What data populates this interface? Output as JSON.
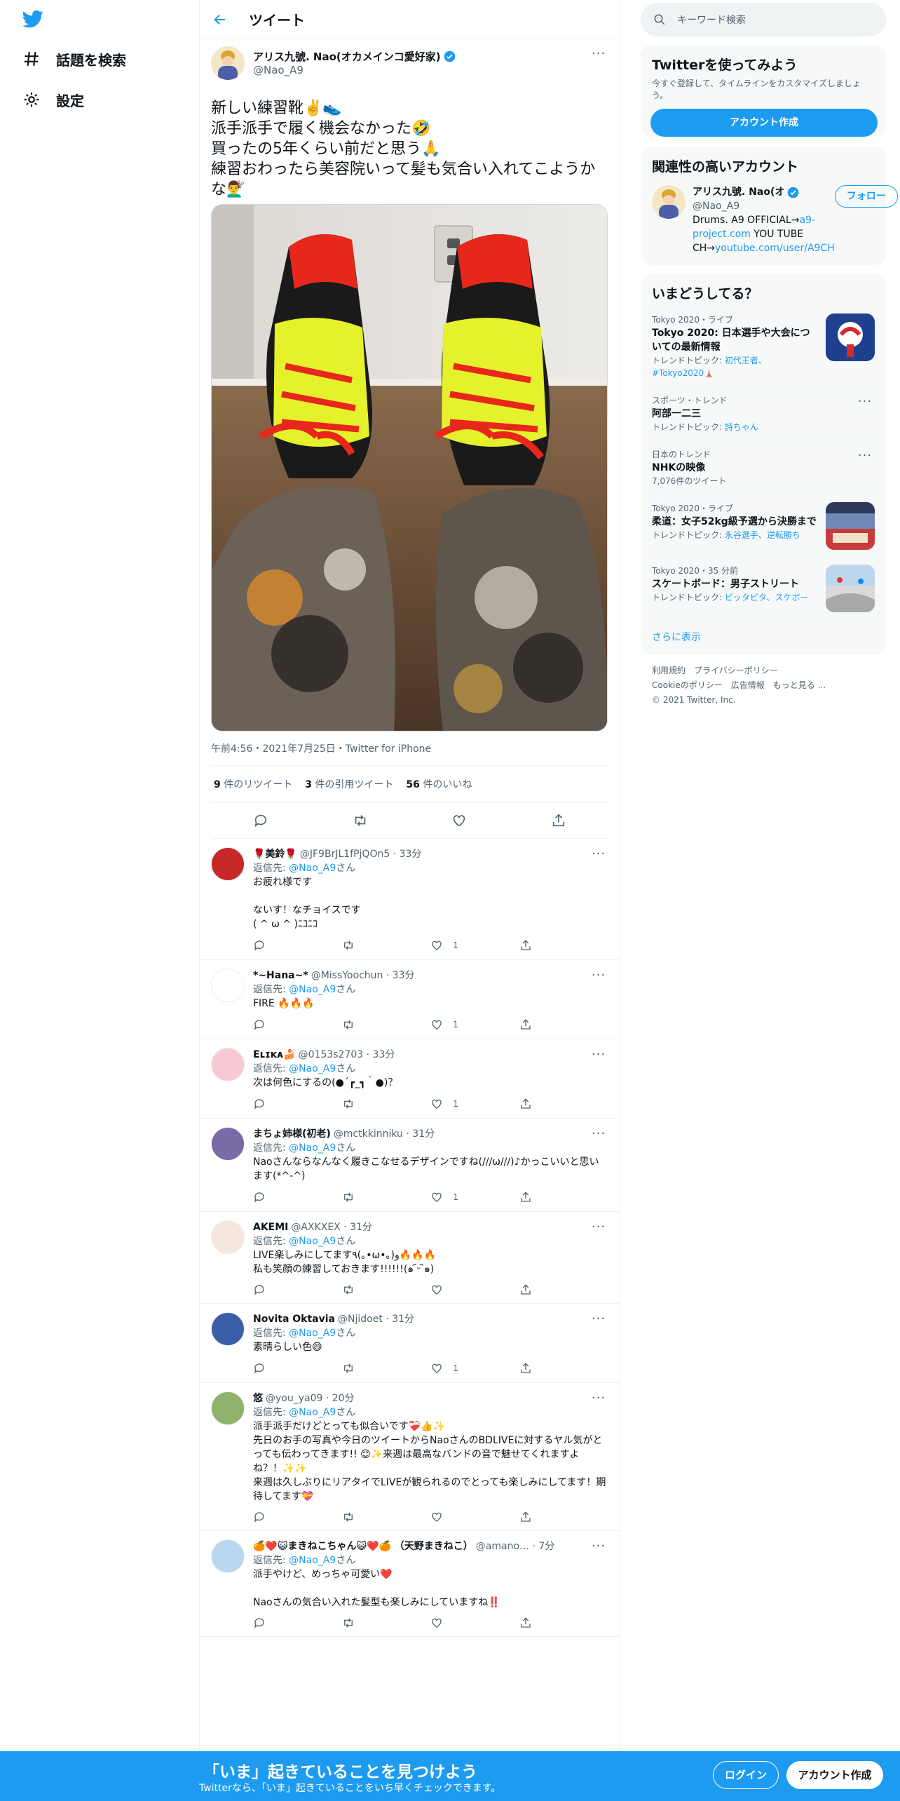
{
  "colors": {
    "accent": "#1d9bf0",
    "text": "#0f1419",
    "muted": "#536471",
    "like": "#f91880"
  },
  "nav": {
    "items": [
      {
        "label": "話題を検索",
        "icon": "hashtag-icon"
      },
      {
        "label": "設定",
        "icon": "gear-icon"
      }
    ]
  },
  "header": {
    "title": "ツイート"
  },
  "tweet": {
    "name": "アリス九號. Nao(オカメインコ愛好家)",
    "handle": "@Nao_A9",
    "text": "新しい練習靴✌️👟\n派手派手で履く機会なかった🤣\n買ったの5年くらい前だと思う🙏\n練習おわったら美容院いって髪も気合い入れてこようかな💇‍♂️",
    "meta": "午前4:56・2021年7月25日・Twitter for iPhone",
    "retweets": "9",
    "retweets_label": "件のリツイート",
    "quotes": "3",
    "quotes_label": "件の引用ツイート",
    "likes": "56",
    "likes_label": "件のいいね"
  },
  "reply_to_label": "返信先: ",
  "reply_to_handle": "@Nao_A9",
  "reply_to_suffix": "さん",
  "replies": [
    {
      "name": "🌹美鈴🌹",
      "handle": "@JF9BrJL1fPjQOn5",
      "time": "33分",
      "text": "お疲れ様です\n\nないす！なチョイスです\n( ^ ω ^ )ﾆｺﾆｺ",
      "likes": "1"
    },
    {
      "name": "*~Hana~*",
      "handle": "@MissYoochun",
      "time": "33分",
      "text": "FIRE 🔥🔥🔥",
      "likes": "1"
    },
    {
      "name": "Eʟɪᴋᴀ🍰",
      "handle": "@0153s2703",
      "time": "33分",
      "text": "次は何色にするの(●´┏_┓｀●)？",
      "likes": "1"
    },
    {
      "name": "まちょ姉様(初老)",
      "handle": "@mctkkinniku",
      "time": "31分",
      "text": "Naoさんならなんなく履きこなせるデザインですね(///ω///)♪かっこいいと思います(*^-^)",
      "likes": "1"
    },
    {
      "name": "AKEMI",
      "handle": "@AXKXEX",
      "time": "31分",
      "text": "LIVE楽しみにしてます٩(｡•ω•｡)و🔥🔥🔥\n私も笑顔の練習しておきます!!!!!!(๑ ᷇ᵕ ᷆๑)",
      "likes": ""
    },
    {
      "name": "Novita Oktavia",
      "handle": "@Njidoet",
      "time": "31分",
      "text": "素晴らしい色😄",
      "likes": "1"
    },
    {
      "name": "悠",
      "handle": "@you_ya09",
      "time": "20分",
      "text": "派手派手だけどとっても似合いです❤️‍🩹👍✨\n先日のお手の写真や今日のツイートからNaoさんのBDLIVEに対するヤル気がとっても伝わってきます!! 😊✨来週は最高なバンドの音で魅せてくれますよね？！✨✨\n来週は久しぶりにリアタイでLIVEが観られるのでとっても楽しみにしてます！期待してます💝",
      "likes": ""
    },
    {
      "name": "🍊❤️😺まきねこちゃん😺❤️🍊 （天野まきねこ）",
      "handle": "@amano…",
      "time": "7分",
      "text": "派手やけど、めっちゃ可愛い❤️\n\nNaoさんの気合い入れた髪型も楽しみにしていますね‼️",
      "likes": ""
    }
  ],
  "search": {
    "placeholder": "キーワード検索"
  },
  "signup": {
    "title": "Twitterを使ってみよう",
    "sub": "今すぐ登録して、タイムラインをカスタマイズしましょう。",
    "button": "アカウント作成"
  },
  "related": {
    "title": "関連性の高いアカウント",
    "name": "アリス九號. Nao(オ",
    "handle": "@Nao_A9",
    "follow": "フォロー",
    "bio_1": "Drums. A9 OFFICIAL→",
    "bio_link_1": "a9-project.com",
    "bio_2": " YOU TUBE CH→",
    "bio_link_2": "youtube.com/user/A9CH"
  },
  "trends": {
    "title": "いまどうしてる？",
    "items": [
      {
        "context": "Tokyo 2020・ライブ",
        "name": "Tokyo 2020: 日本選手や大会についての最新情報",
        "sub_label": "トレンドトピック: ",
        "sub_link": "初代王者、#Tokyo2020🗼",
        "image": "tokyo-2020-image"
      },
      {
        "context": "スポーツ・トレンド",
        "name": "阿部一二三",
        "sub_label": "トレンドトピック: ",
        "sub_link": "詩ちゃん",
        "image": ""
      },
      {
        "context": "日本のトレンド",
        "name": "NHKの映像",
        "sub_label": "7,076件のツイート",
        "sub_link": "",
        "image": ""
      },
      {
        "context": "Tokyo 2020・ライブ",
        "name": "柔道：女子52kg級予選から決勝まで",
        "sub_label": "トレンドトピック: ",
        "sub_link": "永谷選手、逆転勝ち",
        "image": "judo-arena-image"
      },
      {
        "context": "Tokyo 2020・35 分前",
        "name": "スケートボード：男子ストリート",
        "sub_label": "トレンドトピック: ",
        "sub_link": "ピッタピタ、スケボー",
        "image": "skatepark-image"
      }
    ],
    "show_more": "さらに表示"
  },
  "footer": {
    "links": [
      "利用規約",
      "プライバシーポリシー",
      "Cookieのポリシー",
      "広告情報",
      "もっと見る ..."
    ],
    "copyright": "© 2021 Twitter, Inc."
  },
  "banner": {
    "title": "「いま」起きていることを見つけよう",
    "sub": "Twitterなら、「いま」起きていることをいち早くチェックできます。",
    "login": "ログイン",
    "signup": "アカウント作成"
  }
}
